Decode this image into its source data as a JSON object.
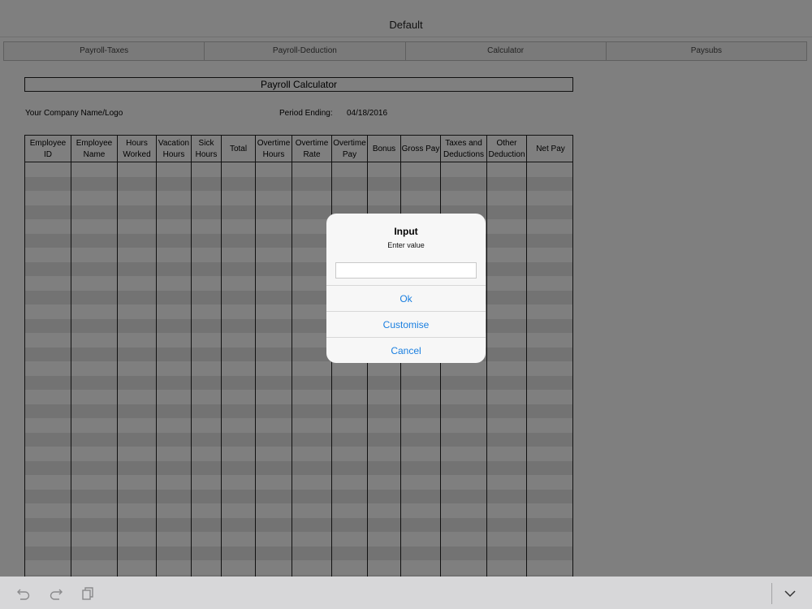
{
  "window": {
    "title": "Default"
  },
  "tabs": [
    {
      "label": "Payroll-Taxes"
    },
    {
      "label": "Payroll-Deduction"
    },
    {
      "label": "Calculator"
    },
    {
      "label": "Paysubs"
    }
  ],
  "sheet": {
    "title": "Payroll Calculator",
    "company": "Your Company Name/Logo",
    "period_label": "Period Ending:",
    "period_value": "04/18/2016",
    "columns": [
      "Employee ID",
      "Employee Name",
      "Hours Worked",
      "Vacation Hours",
      "Sick Hours",
      "Total",
      "Overtime Hours",
      "Overtime Rate",
      "Overtime Pay",
      "Bonus",
      "Gross Pay",
      "Taxes and Deductions",
      "Other Deduction",
      "Net Pay"
    ]
  },
  "dialog": {
    "title": "Input",
    "message": "Enter value",
    "input_value": "",
    "ok": "Ok",
    "customise": "Customise",
    "cancel": "Cancel"
  },
  "toolbar": {
    "icons": [
      "undo-icon",
      "redo-icon",
      "copy-icon",
      "chevron-down-icon"
    ]
  }
}
